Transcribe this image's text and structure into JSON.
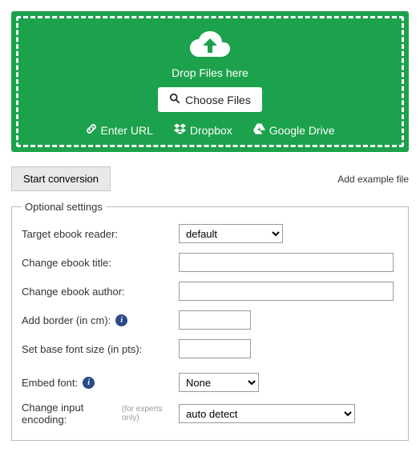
{
  "upload": {
    "drop_text": "Drop Files here",
    "choose_label": "Choose Files",
    "sources": {
      "url": "Enter URL",
      "dropbox": "Dropbox",
      "gdrive": "Google Drive"
    }
  },
  "actions": {
    "start_label": "Start conversion",
    "example_label": "Add example file"
  },
  "optional_legend": "Optional settings",
  "fields": {
    "target_reader": {
      "label": "Target ebook reader:",
      "value": "default"
    },
    "title": {
      "label": "Change ebook title:",
      "value": ""
    },
    "author": {
      "label": "Change ebook author:",
      "value": ""
    },
    "border": {
      "label": "Add border (in cm):",
      "value": ""
    },
    "font_size": {
      "label": "Set base font size (in pts):",
      "value": ""
    },
    "embed_font": {
      "label": "Embed font:",
      "value": "None"
    },
    "encoding": {
      "label": "Change input encoding:",
      "hint": "(for experts only)",
      "value": "auto detect"
    }
  }
}
